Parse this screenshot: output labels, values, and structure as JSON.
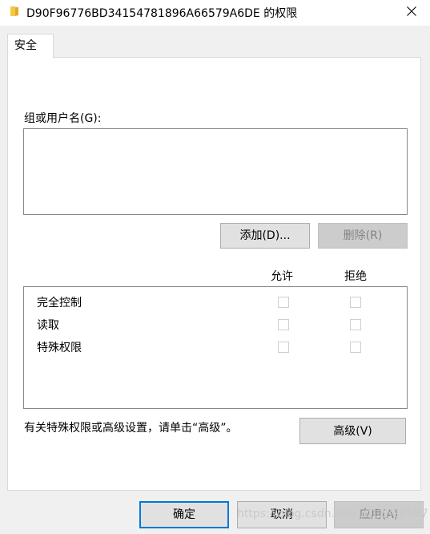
{
  "window": {
    "title": "D90F96776BD34154781896A66579A6DE 的权限",
    "folder_icon": "folder-icon",
    "close_icon": "close-icon"
  },
  "tabs": [
    {
      "label": "安全",
      "selected": true
    }
  ],
  "security": {
    "group_label": "组或用户名(G):",
    "add_button": "添加(D)...",
    "remove_button": "删除(R)",
    "column_allow": "允许",
    "column_deny": "拒绝",
    "permissions": [
      {
        "name": "完全控制",
        "allow": false,
        "deny": false
      },
      {
        "name": "读取",
        "allow": false,
        "deny": false
      },
      {
        "name": "特殊权限",
        "allow": false,
        "deny": false
      }
    ],
    "advanced_text": "有关特殊权限或高级设置，请单击“高级”。",
    "advanced_button": "高级(V)"
  },
  "footer": {
    "ok_button": "确定",
    "cancel_button": "取消",
    "apply_button": "应用(A)"
  },
  "watermark": "https://blog.csdn.net/u012328587",
  "colors": {
    "accent": "#0078d7",
    "panel_border": "#d9d9d9",
    "button_face": "#e1e1e1"
  }
}
